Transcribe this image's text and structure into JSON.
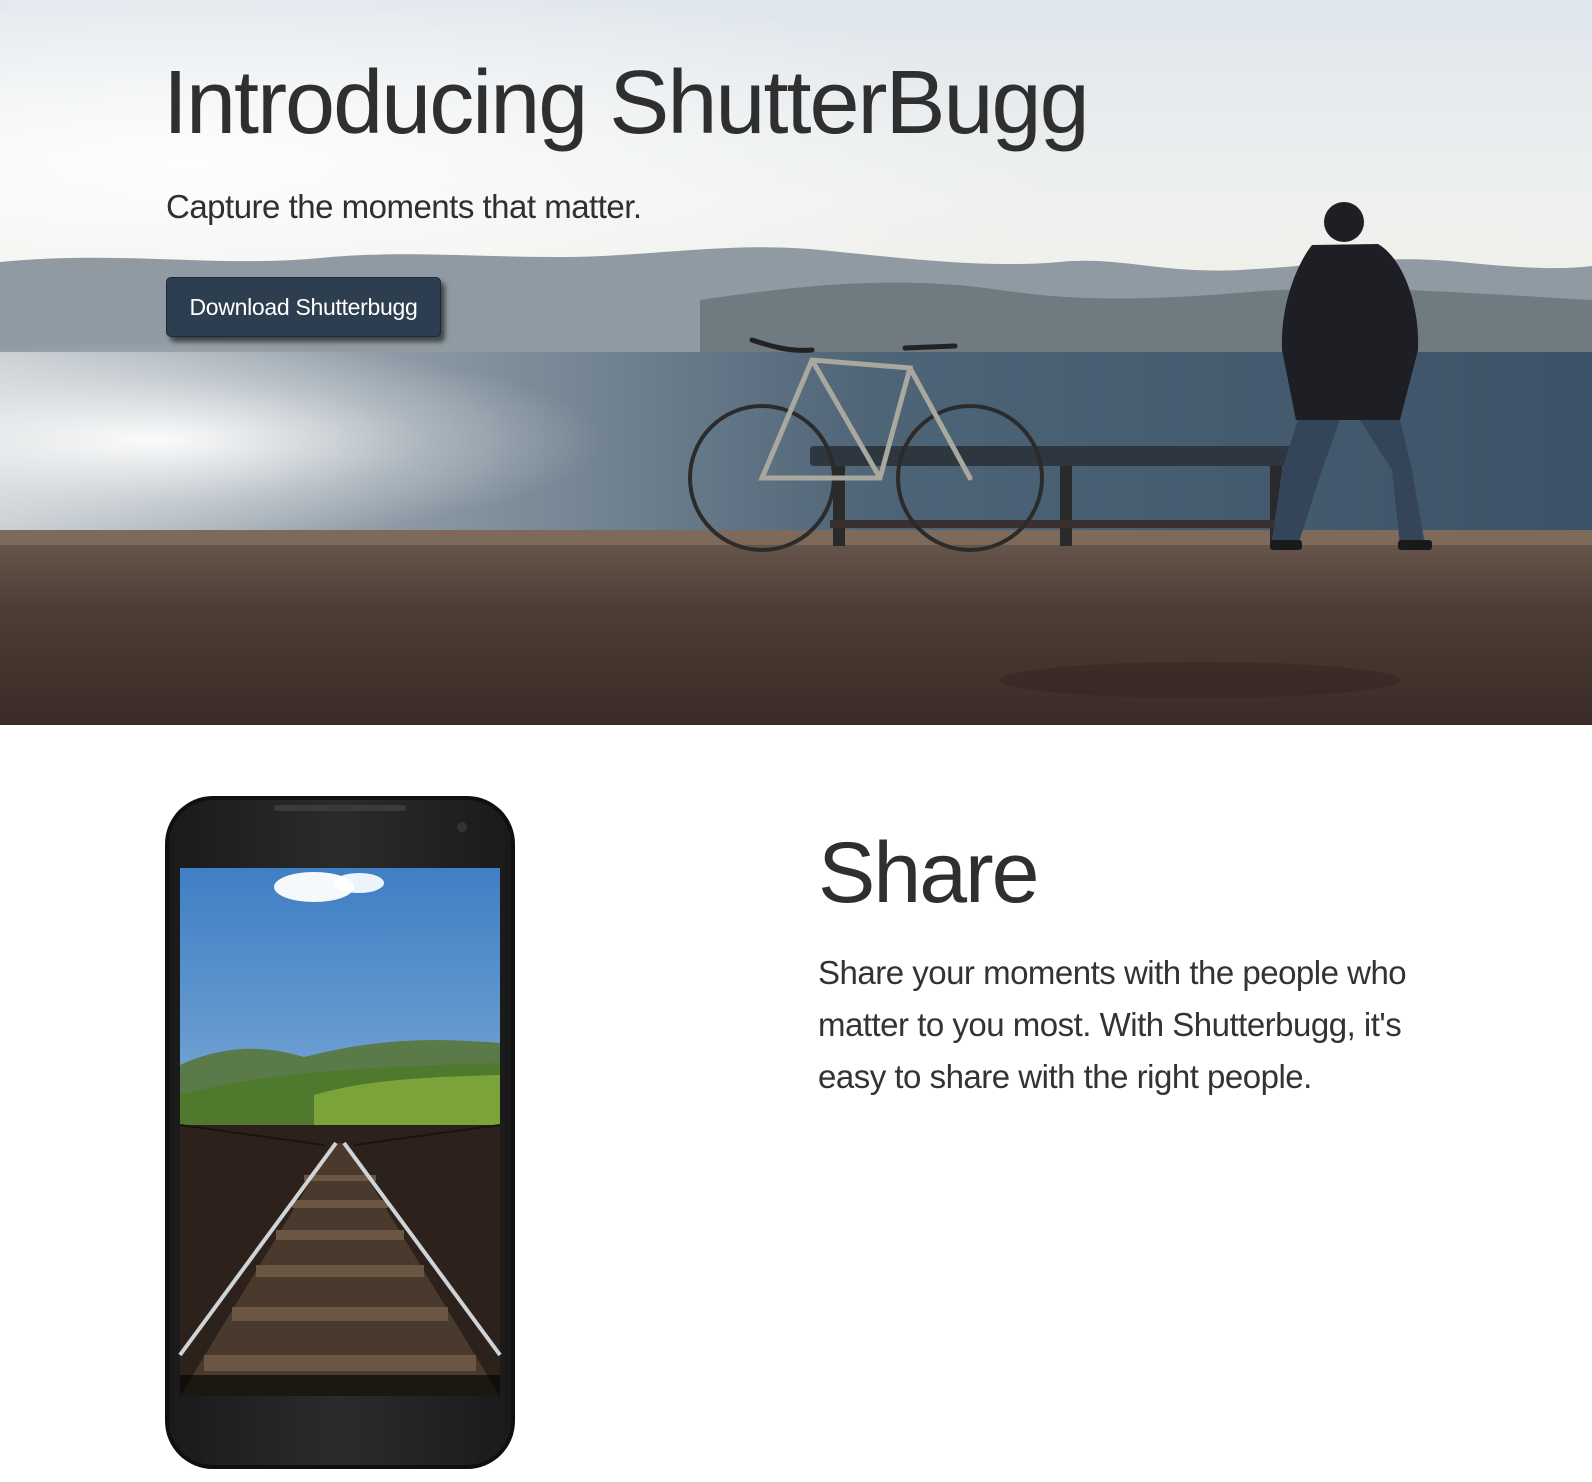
{
  "hero": {
    "title": "Introducing ShutterBugg",
    "subtitle": "Capture the moments that matter.",
    "download_button_label": "Download Shutterbugg"
  },
  "feature": {
    "heading": "Share",
    "body": "Share your moments with the people who matter to you most. With Shutterbugg, it's easy to share with the right people."
  },
  "colors": {
    "button_bg": "#2d3e50",
    "heading_text": "#2f2f2f",
    "body_text": "#333333"
  }
}
